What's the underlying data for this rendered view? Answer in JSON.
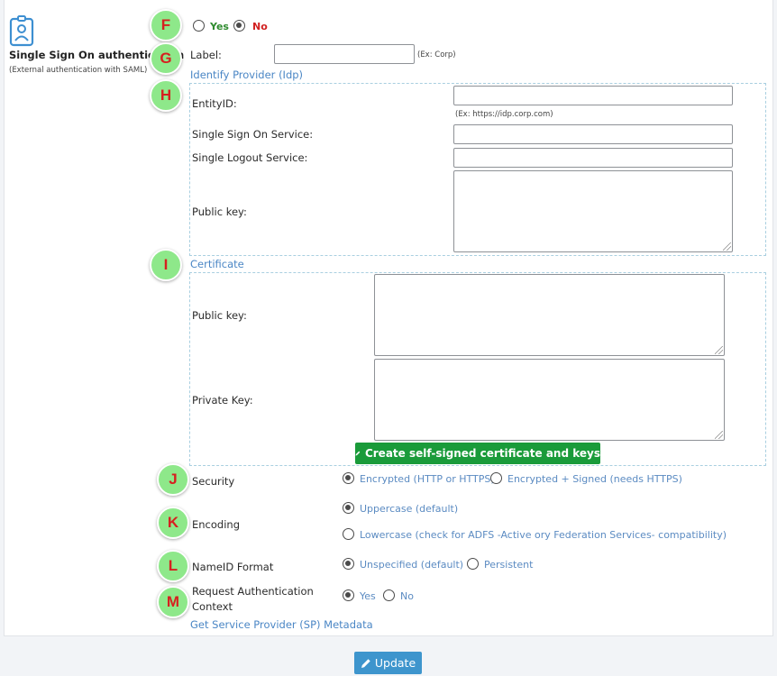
{
  "sso": {
    "title": "Single Sign On authentication",
    "subtitle": "(External authentication with SAML)",
    "enabled_yes": "Yes",
    "enabled_no": "No",
    "selected": "No"
  },
  "markers": [
    "F",
    "G",
    "H",
    "I",
    "J",
    "K",
    "L",
    "M"
  ],
  "label_field": {
    "label": "Label:",
    "value": "",
    "hint": "(Ex: Corp)"
  },
  "idp": {
    "heading": "Identify Provider (Idp)",
    "entity_id_label": "EntityID:",
    "entity_id_value": "",
    "entity_id_hint": "(Ex: https://idp.corp.com)",
    "sso_service_label": "Single Sign On Service:",
    "sso_service_value": "",
    "slo_service_label": "Single Logout Service:",
    "slo_service_value": "",
    "public_key_label": "Public key:",
    "public_key_value": ""
  },
  "certificate": {
    "heading": "Certificate",
    "public_key_label": "Public key:",
    "public_key_value": "",
    "private_key_label": "Private Key:",
    "private_key_value": "",
    "create_button": "Create self-signed certificate and keys"
  },
  "security": {
    "label": "Security",
    "options": [
      "Encrypted (HTTP or HTTPS)",
      "Encrypted + Signed (needs HTTPS)"
    ],
    "selected": "Encrypted (HTTP or HTTPS)"
  },
  "encoding": {
    "label": "Encoding",
    "options": [
      "Uppercase (default)",
      "Lowercase (check for ADFS -Active ory Federation Services- compatibility)"
    ],
    "selected": "Uppercase (default)"
  },
  "nameid": {
    "label": "NameID Format",
    "options": [
      "Unspecified (default)",
      "Persistent"
    ],
    "selected": "Unspecified (default)"
  },
  "request_auth": {
    "label_line1": "Request Authentication",
    "label_line2": "Context",
    "options": [
      "Yes",
      "No"
    ],
    "selected": "Yes"
  },
  "metadata_link": "Get Service Provider (SP) Metadata",
  "update_button": "Update",
  "colors": {
    "accent": "#4a86c5",
    "green_button": "#1a9b3a",
    "blue_button": "#3e95cd",
    "marker_bg": "#8ee88a",
    "marker_text": "#d62020"
  }
}
